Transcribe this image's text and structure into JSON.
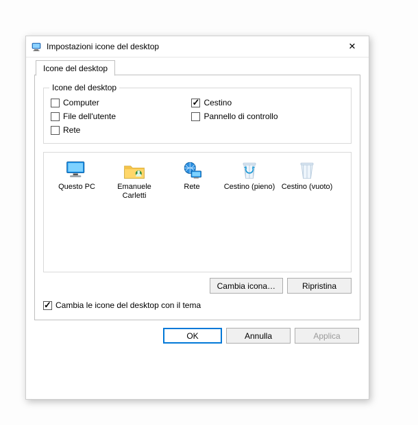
{
  "window": {
    "title": "Impostazioni icone del desktop",
    "close_symbol": "✕"
  },
  "tab": {
    "label": "Icone del desktop"
  },
  "group": {
    "legend": "Icone del desktop",
    "checks": {
      "computer": {
        "label": "Computer",
        "checked": false
      },
      "user": {
        "label": "File dell'utente",
        "checked": false
      },
      "network": {
        "label": "Rete",
        "checked": false
      },
      "recycle": {
        "label": "Cestino",
        "checked": true
      },
      "control": {
        "label": "Pannello di controllo",
        "checked": false
      }
    }
  },
  "preview": {
    "icons": [
      {
        "kind": "pc",
        "label": "Questo PC"
      },
      {
        "kind": "userfolder",
        "label": "Emanuele Carletti"
      },
      {
        "kind": "net",
        "label": "Rete"
      },
      {
        "kind": "bin-full",
        "label": "Cestino (pieno)"
      },
      {
        "kind": "bin-empty",
        "label": "Cestino (vuoto)"
      }
    ]
  },
  "buttons": {
    "change_icon": "Cambia icona…",
    "restore": "Ripristina",
    "theme_check": "Cambia le icone del desktop con il tema",
    "ok": "OK",
    "cancel": "Annulla",
    "apply": "Applica"
  },
  "theme_checked": true,
  "colors": {
    "accent": "#0078d7"
  }
}
